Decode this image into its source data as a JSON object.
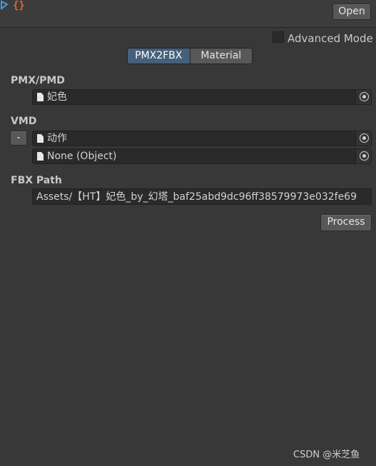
{
  "header": {
    "open_label": "Open"
  },
  "options": {
    "advanced_mode_label": "Advanced Mode",
    "advanced_mode_checked": false
  },
  "tabs": [
    {
      "label": "PMX2FBX",
      "active": true
    },
    {
      "label": "Material",
      "active": false
    }
  ],
  "pmx": {
    "label": "PMX/PMD",
    "value": "妃色"
  },
  "vmd": {
    "label": "VMD",
    "remove_label": "-",
    "items": [
      {
        "value": "动作"
      },
      {
        "value": "None (Object)"
      }
    ]
  },
  "fbx": {
    "label": "FBX Path",
    "value": "Assets/【HT】妃色_by_幻塔_baf25abd9dc96ff38579973e032fe69"
  },
  "actions": {
    "process_label": "Process"
  },
  "watermark": "CSDN @米芝鱼",
  "icons": [
    "logo-icon",
    "file-icon",
    "object-picker-icon"
  ],
  "colors": {
    "background": "#383838",
    "active_tab": "#46607c",
    "field": "#2a2a2a",
    "button": "#585858"
  }
}
